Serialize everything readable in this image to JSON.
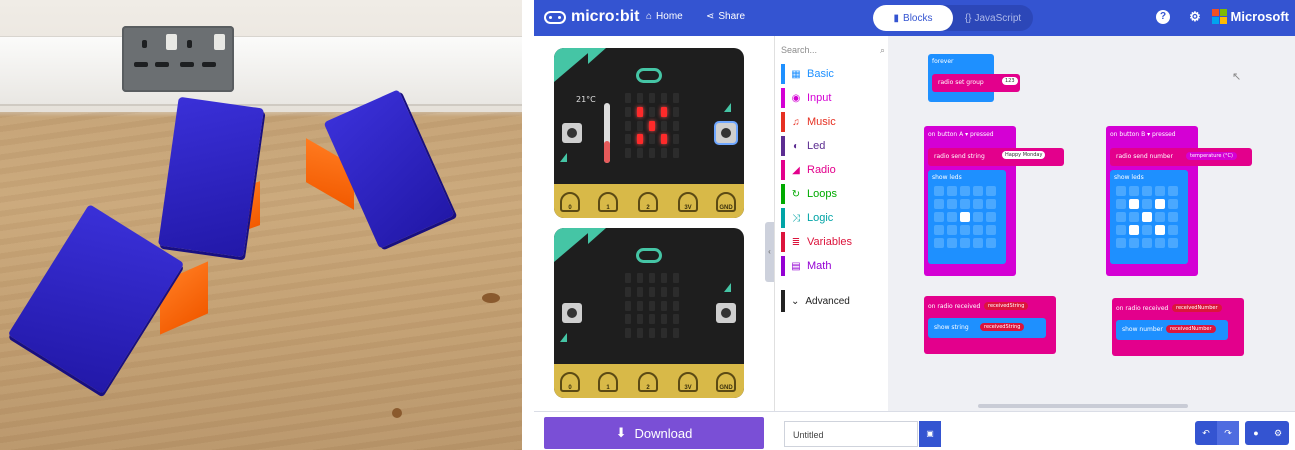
{
  "photo": {
    "description_icon": "phone-stand-photo"
  },
  "header": {
    "brand": "micro:bit",
    "home_label": "Home",
    "share_label": "Share",
    "blocks_label": "Blocks",
    "javascript_label": "JavaScript",
    "ms_label": "Microsoft",
    "accent": "#3454d1"
  },
  "simulator": {
    "temperature": "21°C",
    "pins": [
      "0",
      "1",
      "2",
      "3V",
      "GND"
    ]
  },
  "toolbox": {
    "search_placeholder": "Search...",
    "categories": [
      {
        "label": "Basic",
        "color": "#1e90ff",
        "icon": "grid-icon"
      },
      {
        "label": "Input",
        "color": "#d400d4",
        "icon": "target-icon"
      },
      {
        "label": "Music",
        "color": "#e63022",
        "icon": "headphones-icon"
      },
      {
        "label": "Led",
        "color": "#5c2d91",
        "icon": "toggle-icon"
      },
      {
        "label": "Radio",
        "color": "#e3008c",
        "icon": "signal-icon"
      },
      {
        "label": "Loops",
        "color": "#00aa00",
        "icon": "refresh-icon"
      },
      {
        "label": "Logic",
        "color": "#00a4a6",
        "icon": "shuffle-icon"
      },
      {
        "label": "Variables",
        "color": "#dc143c",
        "icon": "list-icon"
      },
      {
        "label": "Math",
        "color": "#9400d3",
        "icon": "calculator-icon"
      }
    ],
    "advanced_label": "Advanced"
  },
  "workspace": {
    "forever": {
      "title": "forever",
      "stmt": "radio set group",
      "arg": "123"
    },
    "btnA": {
      "title": "on button A ▾ pressed",
      "stmt": "radio send string",
      "arg": "Happy Monday",
      "show": "show leds"
    },
    "btnB": {
      "title": "on button B ▾ pressed",
      "stmt": "radio send number",
      "arg": "temperature (°C)",
      "show": "show leds"
    },
    "recvStr": {
      "title": "on radio received",
      "var": "receivedString",
      "stmt": "show string",
      "arg": "receivedString"
    },
    "recvNum": {
      "title": "on radio received",
      "var": "receivedNumber",
      "stmt": "show number",
      "arg": "receivedNumber"
    }
  },
  "footer": {
    "download_label": "Download",
    "project_name": "Untitled"
  }
}
